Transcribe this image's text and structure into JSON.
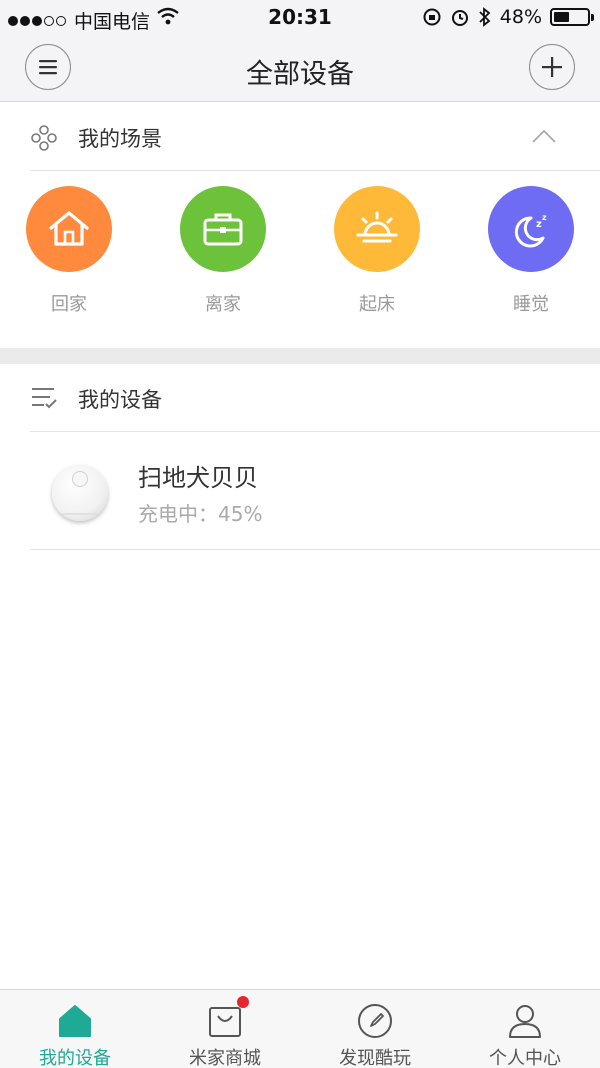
{
  "status_bar": {
    "carrier": "中国电信",
    "time": "20:31",
    "battery": "48%",
    "battery_level": 0.48
  },
  "header": {
    "title": "全部设备",
    "menu_icon": "menu-icon",
    "add_icon": "plus-icon"
  },
  "scenes_section": {
    "title": "我的场景",
    "icon": "scene-cluster-icon",
    "collapse_icon": "chevron-up-icon",
    "items": [
      {
        "label": "回家",
        "icon": "home-icon",
        "color": "#ff8a3d"
      },
      {
        "label": "离家",
        "icon": "briefcase-icon",
        "color": "#6cc23a"
      },
      {
        "label": "起床",
        "icon": "sunrise-icon",
        "color": "#ffb938"
      },
      {
        "label": "睡觉",
        "icon": "moon-icon",
        "color": "#6d6cf2"
      }
    ]
  },
  "devices_section": {
    "title": "我的设备",
    "icon": "list-check-icon",
    "devices": [
      {
        "name": "扫地犬贝贝",
        "status": "充电中：45%",
        "icon": "robot-vacuum-icon"
      }
    ]
  },
  "tabbar": {
    "active_color": "#1eaa94",
    "tabs": [
      {
        "label": "我的设备",
        "icon": "home-tab-icon",
        "active": true
      },
      {
        "label": "米家商城",
        "icon": "shopping-bag-icon",
        "badge": true
      },
      {
        "label": "发现酷玩",
        "icon": "compass-icon"
      },
      {
        "label": "个人中心",
        "icon": "person-icon"
      }
    ]
  }
}
